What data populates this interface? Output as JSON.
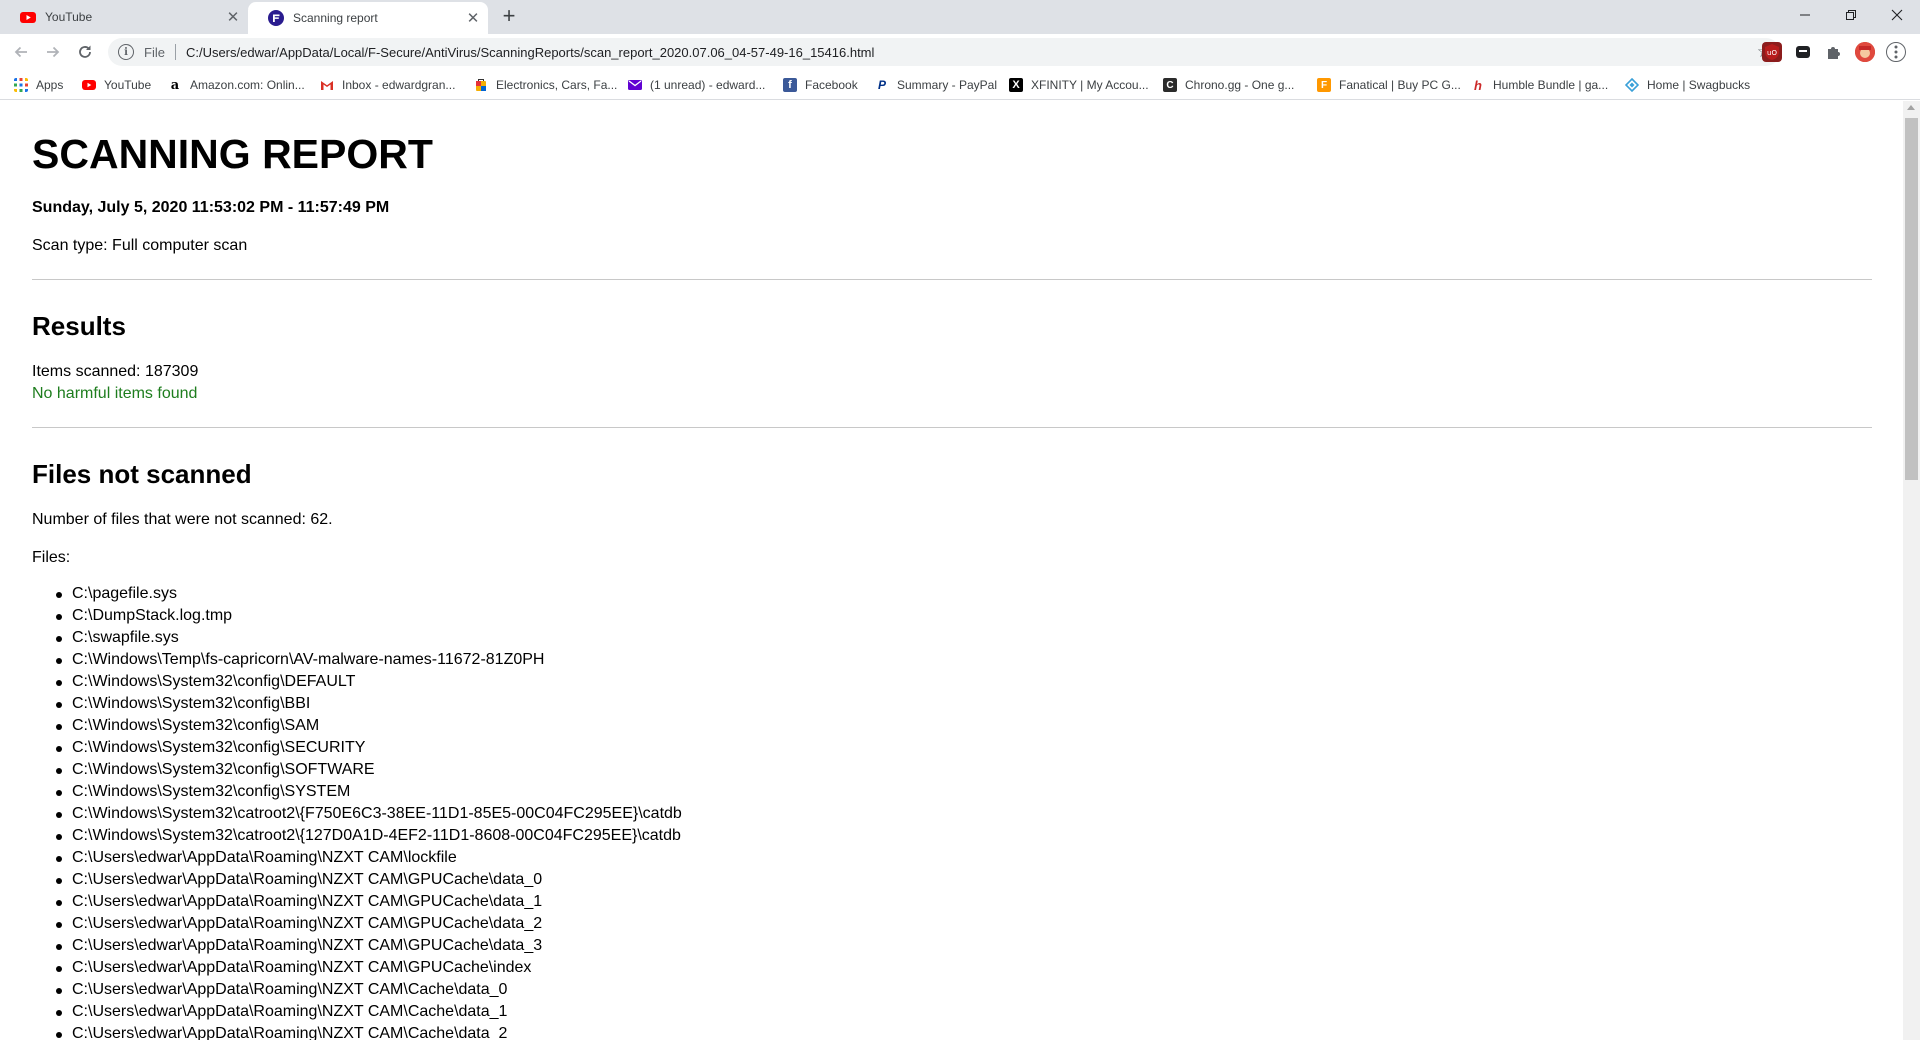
{
  "browser": {
    "tabs": [
      {
        "title": "YouTube",
        "favicon": "youtube-icon",
        "active": false
      },
      {
        "title": "Scanning report",
        "favicon": "f-secure-icon",
        "active": true
      }
    ],
    "address": {
      "scheme_label": "File",
      "url": "C:/Users/edwar/AppData/Local/F-Secure/AntiVirus/ScanningReports/scan_report_2020.07.06_04-57-49-16_15416.html"
    },
    "bookmarks": [
      {
        "label": "Apps",
        "icon": "apps-grid-icon"
      },
      {
        "label": "YouTube",
        "icon": "youtube-icon"
      },
      {
        "label": "Amazon.com: Onlin...",
        "icon": "amazon-icon"
      },
      {
        "label": "Inbox - edwardgran...",
        "icon": "gmail-icon"
      },
      {
        "label": "Electronics, Cars, Fa...",
        "icon": "ebay-icon"
      },
      {
        "label": "(1 unread) - edward...",
        "icon": "yahoo-mail-icon"
      },
      {
        "label": "Facebook",
        "icon": "facebook-icon"
      },
      {
        "label": "Summary - PayPal",
        "icon": "paypal-icon"
      },
      {
        "label": "XFINITY | My Accou...",
        "icon": "xfinity-icon"
      },
      {
        "label": "Chrono.gg - One g...",
        "icon": "chrono-icon"
      },
      {
        "label": "Fanatical | Buy PC G...",
        "icon": "fanatical-icon"
      },
      {
        "label": "Humble Bundle | ga...",
        "icon": "humble-icon"
      },
      {
        "label": "Home | Swagbucks",
        "icon": "swagbucks-icon"
      }
    ]
  },
  "report": {
    "title": "SCANNING REPORT",
    "datetime": "Sunday, July 5, 2020 11:53:02 PM - 11:57:49 PM",
    "scan_type": "Scan type: Full computer scan",
    "results": {
      "heading": "Results",
      "items_scanned": "Items scanned: 187309",
      "status": "No harmful items found"
    },
    "not_scanned": {
      "heading": "Files not scanned",
      "count_text": "Number of files that were not scanned: 62.",
      "files_label": "Files:",
      "files": [
        "C:\\pagefile.sys",
        "C:\\DumpStack.log.tmp",
        "C:\\swapfile.sys",
        "C:\\Windows\\Temp\\fs-capricorn\\AV-malware-names-11672-81Z0PH",
        "C:\\Windows\\System32\\config\\DEFAULT",
        "C:\\Windows\\System32\\config\\BBI",
        "C:\\Windows\\System32\\config\\SAM",
        "C:\\Windows\\System32\\config\\SECURITY",
        "C:\\Windows\\System32\\config\\SOFTWARE",
        "C:\\Windows\\System32\\config\\SYSTEM",
        "C:\\Windows\\System32\\catroot2\\{F750E6C3-38EE-11D1-85E5-00C04FC295EE}\\catdb",
        "C:\\Windows\\System32\\catroot2\\{127D0A1D-4EF2-11D1-8608-00C04FC295EE}\\catdb",
        "C:\\Users\\edwar\\AppData\\Roaming\\NZXT CAM\\lockfile",
        "C:\\Users\\edwar\\AppData\\Roaming\\NZXT CAM\\GPUCache\\data_0",
        "C:\\Users\\edwar\\AppData\\Roaming\\NZXT CAM\\GPUCache\\data_1",
        "C:\\Users\\edwar\\AppData\\Roaming\\NZXT CAM\\GPUCache\\data_2",
        "C:\\Users\\edwar\\AppData\\Roaming\\NZXT CAM\\GPUCache\\data_3",
        "C:\\Users\\edwar\\AppData\\Roaming\\NZXT CAM\\GPUCache\\index",
        "C:\\Users\\edwar\\AppData\\Roaming\\NZXT CAM\\Cache\\data_0",
        "C:\\Users\\edwar\\AppData\\Roaming\\NZXT CAM\\Cache\\data_1",
        "C:\\Users\\edwar\\AppData\\Roaming\\NZXT CAM\\Cache\\data_2"
      ]
    }
  },
  "colors": {
    "ok_text": "#1e7d1e",
    "tabstrip_bg": "#dee1e6",
    "omnibox_bg": "#f1f3f4"
  }
}
